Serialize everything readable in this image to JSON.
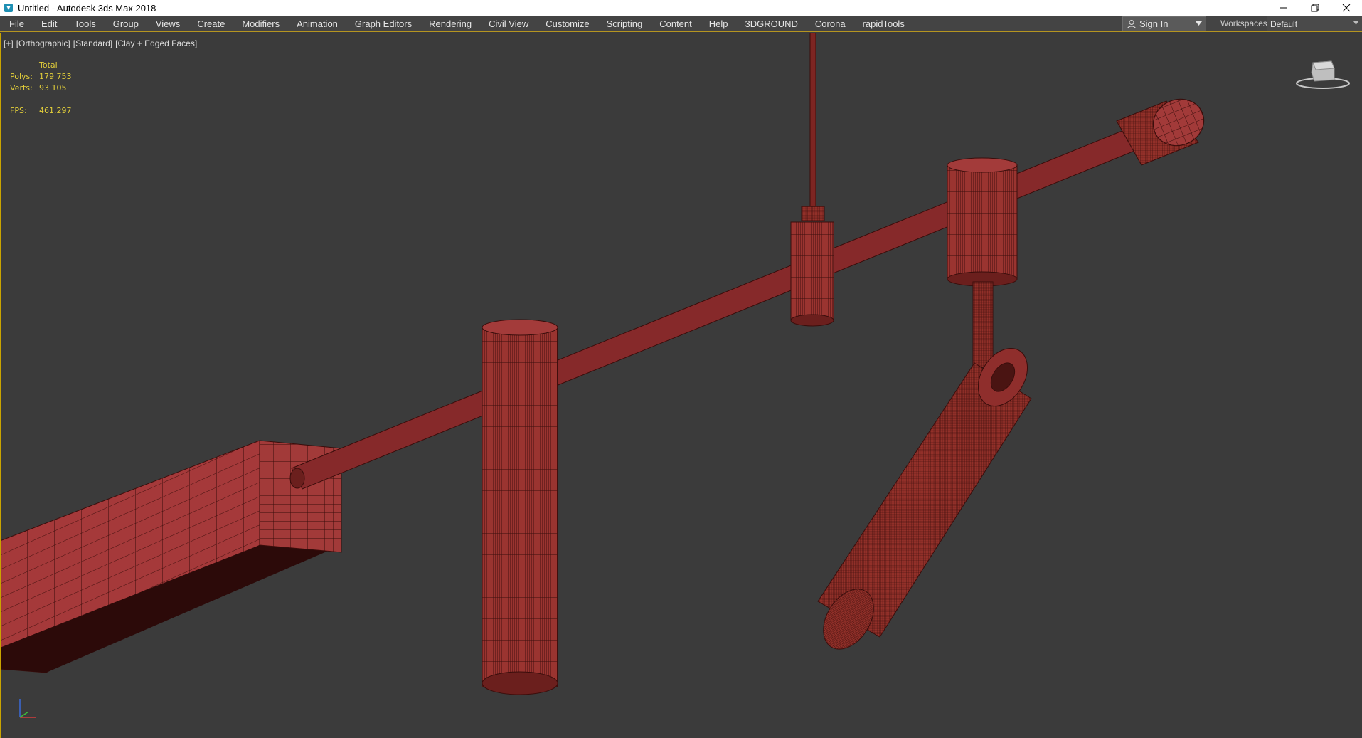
{
  "window": {
    "title": "Untitled - Autodesk 3ds Max 2018"
  },
  "menu": {
    "items": [
      "File",
      "Edit",
      "Tools",
      "Group",
      "Views",
      "Create",
      "Modifiers",
      "Animation",
      "Graph Editors",
      "Rendering",
      "Civil View",
      "Customize",
      "Scripting",
      "Content",
      "Help",
      "3DGROUND",
      "Corona",
      "rapidTools"
    ]
  },
  "account": {
    "sign_in_label": "Sign In",
    "workspaces_label": "Workspaces:",
    "workspace_value": "Default"
  },
  "viewport": {
    "labels": [
      "[+]",
      "[Orthographic]",
      "[Standard]",
      "[Clay + Edged Faces]"
    ],
    "stats": {
      "header": "Total",
      "polys_label": "Polys:",
      "polys_value": "179 753",
      "verts_label": "Verts:",
      "verts_value": "93 105",
      "fps_label": "FPS:",
      "fps_value": "461,297"
    },
    "icons": {
      "viewcube": "viewcube-icon",
      "axis": "axis-gizmo-icon"
    }
  },
  "colors": {
    "clay": "#9a3430",
    "clay_dark": "#5a1a17",
    "wire": "#3a0d0b",
    "background": "#3b3b3b",
    "accent": "#c9a400"
  }
}
